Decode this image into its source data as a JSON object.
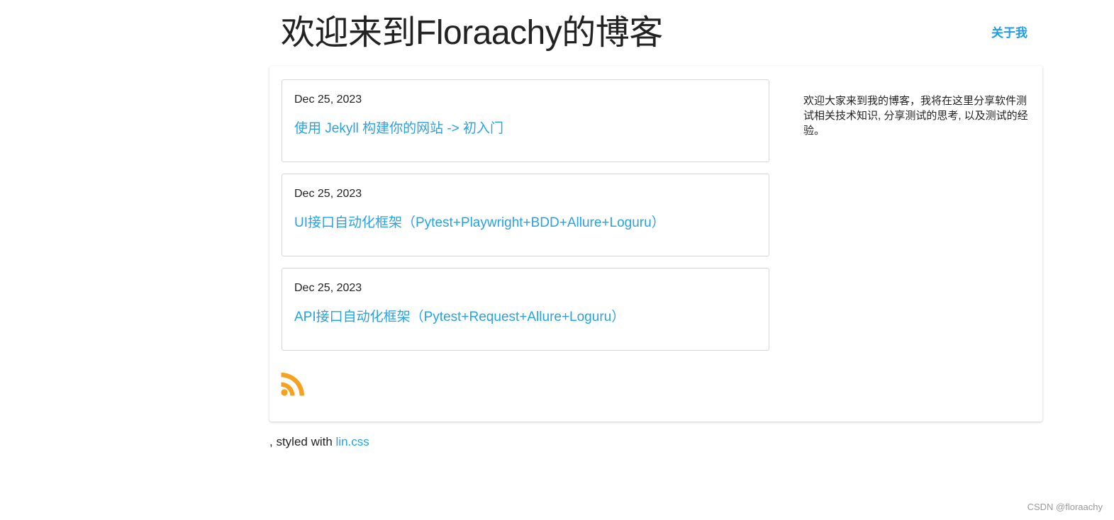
{
  "header": {
    "title": "欢迎来到Floraachy的博客",
    "nav_about": "关于我"
  },
  "posts": [
    {
      "date": "Dec 25, 2023",
      "title": "使用 Jekyll 构建你的网站 -> 初入门"
    },
    {
      "date": "Dec 25, 2023",
      "title": "UI接口自动化框架（Pytest+Playwright+BDD+Allure+Loguru）"
    },
    {
      "date": "Dec 25, 2023",
      "title": "API接口自动化框架（Pytest+Request+Allure+Loguru）"
    }
  ],
  "sidebar": {
    "description": "欢迎大家来到我的博客，我将在这里分享软件测试相关技术知识, 分享测试的思考, 以及测试的经验。"
  },
  "rss": {
    "icon": "rss-icon",
    "color": "#f6a21e"
  },
  "footer": {
    "prefix": ", styled with ",
    "link_text": "lin.css"
  },
  "watermark": "CSDN @floraachy",
  "colors": {
    "link": "#27a2e5",
    "nav": "#1e9be9",
    "rss": "#f6a21e"
  }
}
